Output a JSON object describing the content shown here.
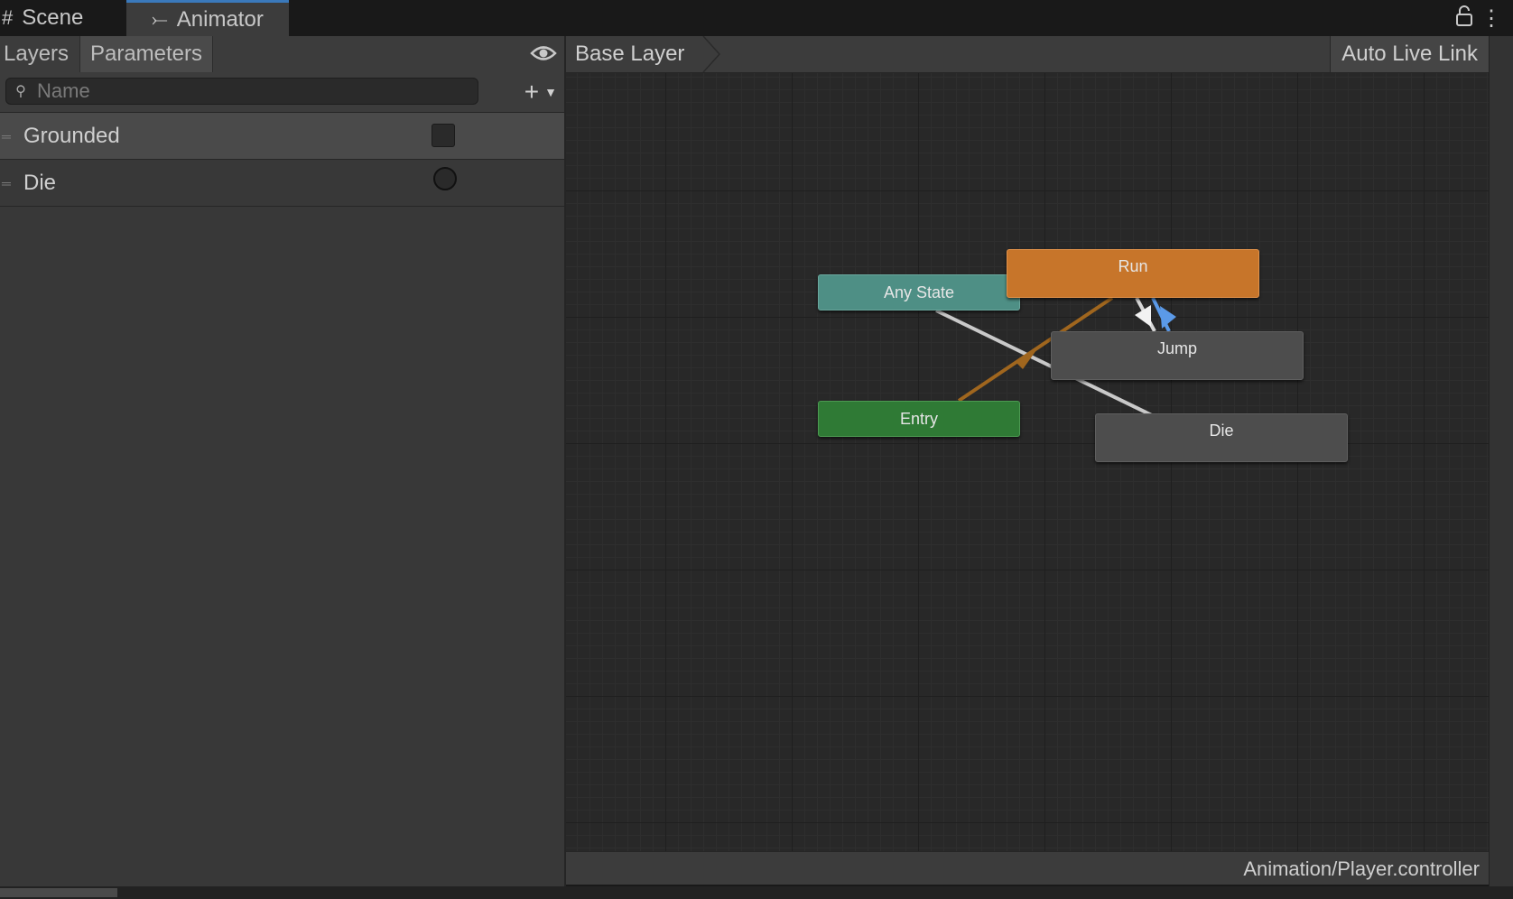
{
  "tabs": {
    "scene": "Scene",
    "animator": "Animator"
  },
  "left_panel": {
    "tabs": {
      "layers": "Layers",
      "parameters": "Parameters"
    },
    "search": {
      "placeholder": "Name"
    },
    "parameters": [
      {
        "name": "Grounded",
        "type": "bool"
      },
      {
        "name": "Die",
        "type": "trigger"
      }
    ]
  },
  "graph": {
    "breadcrumb": "Base Layer",
    "auto_live_link": "Auto Live Link",
    "states": {
      "any_state": "Any State",
      "run": "Run",
      "jump": "Jump",
      "entry": "Entry",
      "die": "Die"
    },
    "footer_path": "Animation/Player.controller"
  },
  "colors": {
    "any_state": "#4e8f85",
    "run": "#c7752a",
    "entry": "#2f7a35",
    "state": "#4d4d4d",
    "transition_selected": "#5b9ae8",
    "transition_entry": "#a0661e"
  },
  "icons": [
    "grid-icon",
    "animator-icon",
    "lock-icon",
    "kebab-menu-icon",
    "eye-icon",
    "search-icon",
    "add-icon",
    "dropdown-caret-icon"
  ]
}
